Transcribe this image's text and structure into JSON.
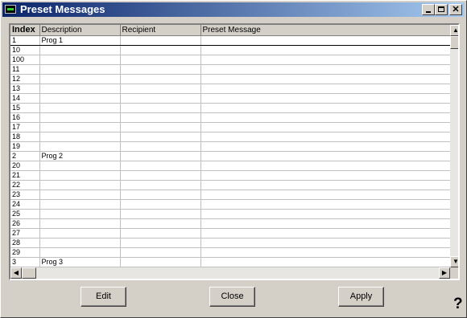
{
  "window": {
    "title": "Preset Messages"
  },
  "icons": {
    "app": "terminal-icon",
    "minimize": "minimize-icon",
    "maximize": "maximize-icon",
    "close": "close-icon",
    "help": "help-icon"
  },
  "titlebar_buttons": {
    "close_glyph": "✕"
  },
  "table": {
    "columns": [
      "Index",
      "Description",
      "Recipient",
      "Preset Message"
    ],
    "rows": [
      {
        "index": "1",
        "description": "Prog 1",
        "recipient": "",
        "message": ""
      },
      {
        "index": "10",
        "description": "",
        "recipient": "",
        "message": ""
      },
      {
        "index": "100",
        "description": "",
        "recipient": "",
        "message": ""
      },
      {
        "index": "11",
        "description": "",
        "recipient": "",
        "message": ""
      },
      {
        "index": "12",
        "description": "",
        "recipient": "",
        "message": ""
      },
      {
        "index": "13",
        "description": "",
        "recipient": "",
        "message": ""
      },
      {
        "index": "14",
        "description": "",
        "recipient": "",
        "message": ""
      },
      {
        "index": "15",
        "description": "",
        "recipient": "",
        "message": ""
      },
      {
        "index": "16",
        "description": "",
        "recipient": "",
        "message": ""
      },
      {
        "index": "17",
        "description": "",
        "recipient": "",
        "message": ""
      },
      {
        "index": "18",
        "description": "",
        "recipient": "",
        "message": ""
      },
      {
        "index": "19",
        "description": "",
        "recipient": "",
        "message": ""
      },
      {
        "index": "2",
        "description": "Prog 2",
        "recipient": "",
        "message": ""
      },
      {
        "index": "20",
        "description": "",
        "recipient": "",
        "message": ""
      },
      {
        "index": "21",
        "description": "",
        "recipient": "",
        "message": ""
      },
      {
        "index": "22",
        "description": "",
        "recipient": "",
        "message": ""
      },
      {
        "index": "23",
        "description": "",
        "recipient": "",
        "message": ""
      },
      {
        "index": "24",
        "description": "",
        "recipient": "",
        "message": ""
      },
      {
        "index": "25",
        "description": "",
        "recipient": "",
        "message": ""
      },
      {
        "index": "26",
        "description": "",
        "recipient": "",
        "message": ""
      },
      {
        "index": "27",
        "description": "",
        "recipient": "",
        "message": ""
      },
      {
        "index": "28",
        "description": "",
        "recipient": "",
        "message": ""
      },
      {
        "index": "29",
        "description": "",
        "recipient": "",
        "message": ""
      },
      {
        "index": "3",
        "description": "Prog 3",
        "recipient": "",
        "message": ""
      }
    ],
    "selected_row": 0
  },
  "scrollbar_glyphs": {
    "up": "▲",
    "down": "▼",
    "left": "◀",
    "right": "▶"
  },
  "buttons": {
    "edit": "Edit",
    "close": "Close",
    "apply": "Apply"
  },
  "help_glyph": "?",
  "colors": {
    "title_start": "#0a246a",
    "title_end": "#a6caf0",
    "face": "#d4d0c8"
  }
}
